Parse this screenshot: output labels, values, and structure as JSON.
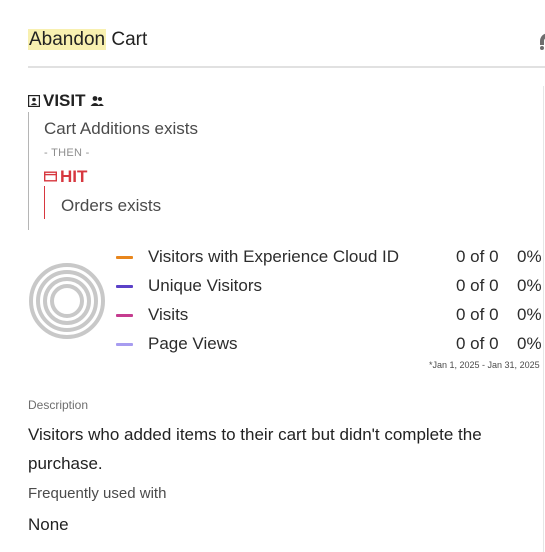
{
  "header": {
    "title_highlight": "Abandon",
    "title_rest": " Cart",
    "action_icon": "share-icon"
  },
  "rule": {
    "container_label": "VISIT",
    "container_icon": "visit-icon",
    "container_people_icon": "people-icon",
    "condition1": "Cart Additions exists",
    "then_label": "- THEN -",
    "hit_label": "HIT",
    "hit_icon": "hit-icon",
    "condition2": "Orders exists"
  },
  "stats": {
    "items": [
      {
        "label": "Visitors with Experience Cloud ID",
        "count": "0 of 0",
        "pct": "0%",
        "color": "#e8861d"
      },
      {
        "label": "Unique Visitors",
        "count": "0 of 0",
        "pct": "0%",
        "color": "#5b41c8"
      },
      {
        "label": "Visits",
        "count": "0 of 0",
        "pct": "0%",
        "color": "#c53c8f"
      },
      {
        "label": "Page Views",
        "count": "0 of 0",
        "pct": "0%",
        "color": "#a79cf0"
      }
    ],
    "date_range": "*Jan 1, 2025 - Jan 31, 2025",
    "donut_ring_color": "#c8c8c8"
  },
  "description": {
    "label": "Description",
    "text": "Visitors who added items to their cart but didn't complete the purchase."
  },
  "frequently_used": {
    "label": "Frequently used with",
    "value": "None"
  }
}
